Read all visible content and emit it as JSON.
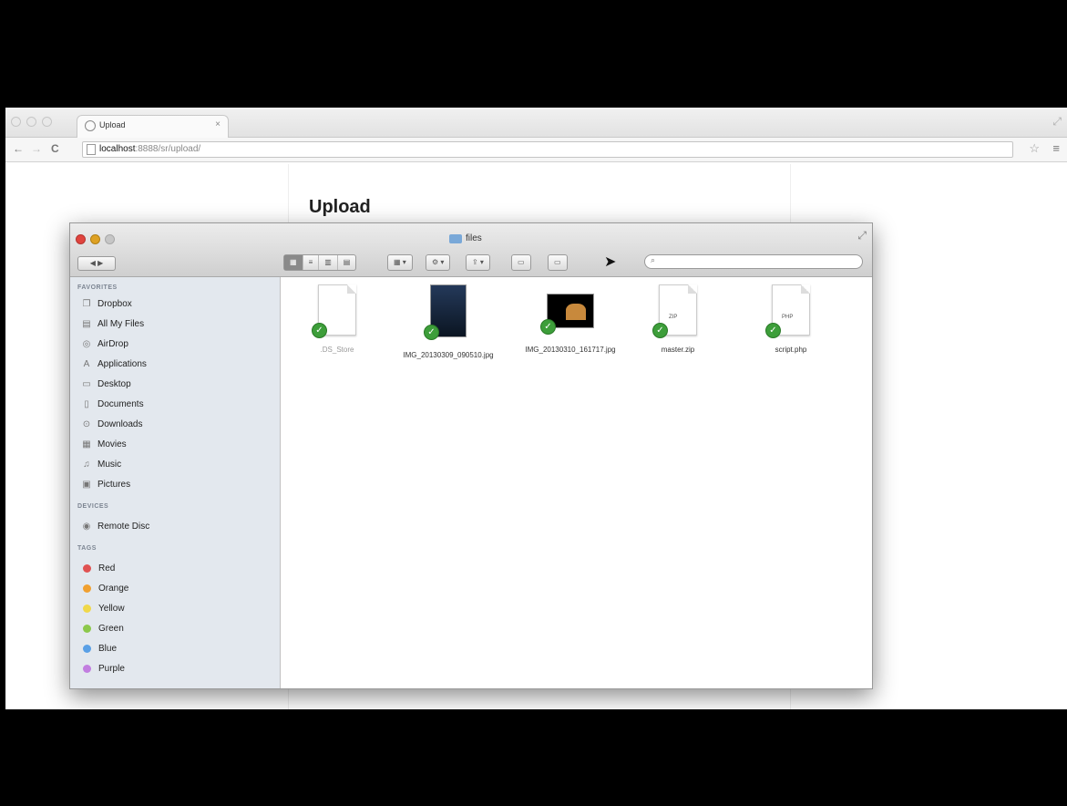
{
  "browser": {
    "tab_title": "Upload",
    "tab_close": "×",
    "url_host": "localhost",
    "url_path": ":8888/sr/upload/",
    "back": "←",
    "forward": "→",
    "reload": "C",
    "star": "☆",
    "menu": "≡"
  },
  "page": {
    "title": "Upload"
  },
  "finder": {
    "title": "files",
    "back_forward": "◀ ▶",
    "views": [
      "▦",
      "≡",
      "▥",
      "▤"
    ],
    "arrange": "▦ ▾",
    "action": "⚙ ▾",
    "share": "⇪ ▾",
    "buttons": [
      "▭",
      "▭"
    ],
    "search_icon": "🔍",
    "sidebar": {
      "favorites_heading": "FAVORITES",
      "favorites": [
        {
          "label": "Dropbox",
          "icon": "❐"
        },
        {
          "label": "All My Files",
          "icon": "▤"
        },
        {
          "label": "AirDrop",
          "icon": "◎"
        },
        {
          "label": "Applications",
          "icon": "A"
        },
        {
          "label": "Desktop",
          "icon": "▭"
        },
        {
          "label": "Documents",
          "icon": "▯"
        },
        {
          "label": "Downloads",
          "icon": "⊙"
        },
        {
          "label": "Movies",
          "icon": "▦"
        },
        {
          "label": "Music",
          "icon": "♫"
        },
        {
          "label": "Pictures",
          "icon": "▣"
        }
      ],
      "devices_heading": "DEVICES",
      "devices": [
        {
          "label": "Remote Disc",
          "icon": "◉"
        }
      ],
      "tags_heading": "TAGS",
      "tags": [
        {
          "label": "Red",
          "color": "#e05252"
        },
        {
          "label": "Orange",
          "color": "#f0a030"
        },
        {
          "label": "Yellow",
          "color": "#f0d84a"
        },
        {
          "label": "Green",
          "color": "#8cc84b"
        },
        {
          "label": "Blue",
          "color": "#5aa0e6"
        },
        {
          "label": "Purple",
          "color": "#c27ee0"
        }
      ]
    },
    "files": [
      {
        "name": ".DS_Store",
        "kind": "doc",
        "dim": true
      },
      {
        "name": "IMG_20130309_090510.jpg",
        "kind": "portrait"
      },
      {
        "name": "IMG_20130310_161717.jpg",
        "kind": "landscape"
      },
      {
        "name": "master.zip",
        "kind": "doc",
        "ext": "ZIP"
      },
      {
        "name": "script.php",
        "kind": "doc",
        "ext": "PHP"
      }
    ],
    "check_mark": "✓"
  }
}
